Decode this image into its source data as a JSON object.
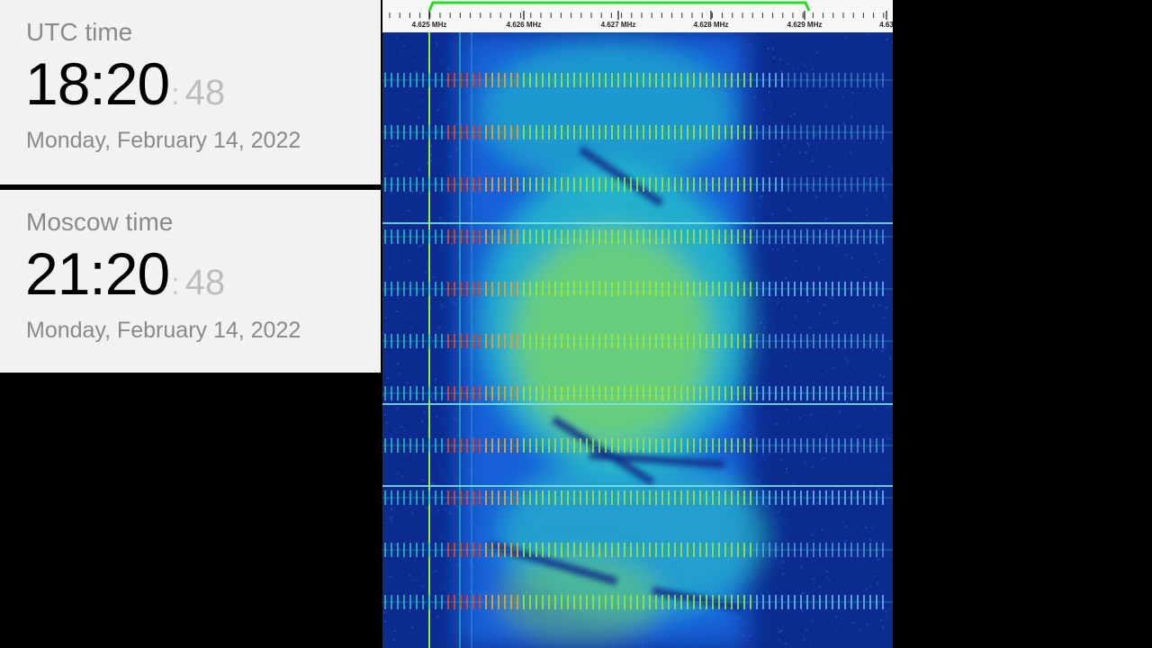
{
  "utc_clock": {
    "label": "UTC time",
    "hours_minutes": "18:20",
    "colon": ":",
    "seconds": "48",
    "date": "Monday, February 14, 2022"
  },
  "moscow_clock": {
    "label": "Moscow time",
    "hours_minutes": "21:20",
    "colon": ":",
    "seconds": "48",
    "date": "Monday, February 14, 2022"
  },
  "receiver": {
    "frequency_labels": [
      "4.625 MHz",
      "4.626 MHz",
      "4.627 MHz",
      "4.628 MHz",
      "4.629 MHz",
      "4.63"
    ],
    "colors": {
      "ruler_background": "#f7f7f7",
      "passband": "#22dd22",
      "waterfall_background": "#0b2b8f",
      "signal_low": "#1565e0",
      "signal_mid": "#28c8c8",
      "signal_high": "#9ee83a",
      "signal_peak": "#e0402a"
    }
  }
}
